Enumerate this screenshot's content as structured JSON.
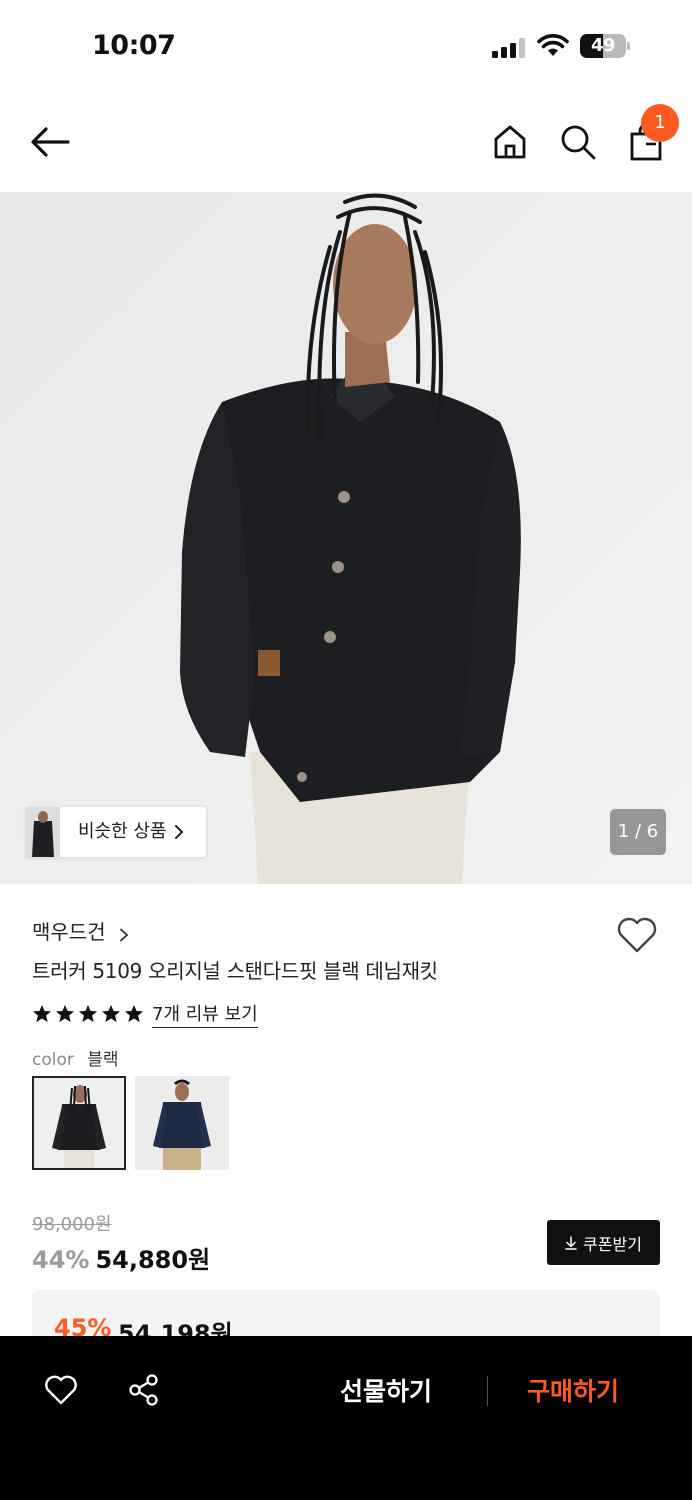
{
  "status_bar": {
    "time": "10:07",
    "battery_level": "49",
    "battery_fraction": 0.49
  },
  "header": {
    "back_icon": "arrow-left-icon",
    "home_icon": "home-icon",
    "search_icon": "search-icon",
    "bag_icon": "shopping-bag-icon",
    "cart_count": "1"
  },
  "gallery": {
    "similar_label": "비슷한 상품",
    "page_indicator": "1 / 6",
    "current_page": 1,
    "total_pages": 6
  },
  "product": {
    "brand": "맥우드건",
    "name": "트러커 5109 오리지널 스탠다드핏 블랙 데님재킷",
    "rating_stars": 5,
    "reviews_link": "7개 리뷰 보기",
    "color_label": "color",
    "color_value": "블랙",
    "swatches": [
      "black",
      "navy"
    ]
  },
  "price": {
    "original": "98,000원",
    "discount": "44%",
    "sale": "54,880원",
    "coupon_label": "쿠폰받기",
    "promo_discount": "45%",
    "promo_price": "54,198원"
  },
  "bottom_bar": {
    "gift_label": "선물하기",
    "buy_label": "구매하기"
  },
  "colors": {
    "accent": "#ff5a1f",
    "bottom_bar_bg": "#000000"
  }
}
